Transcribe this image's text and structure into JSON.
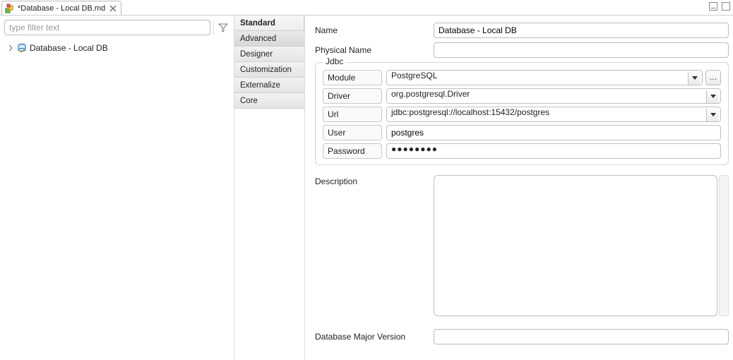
{
  "tab": {
    "title": "*Database - Local DB.md"
  },
  "filter": {
    "placeholder": "type filter text"
  },
  "tree": {
    "root_label": "Database - Local DB"
  },
  "prop_section": {
    "header": "Standard",
    "items": [
      "Advanced",
      "Designer",
      "Customization",
      "Externalize",
      "Core"
    ],
    "selected_index": 0
  },
  "form": {
    "name_label": "Name",
    "name_value": "Database - Local DB",
    "physical_name_label": "Physical Name",
    "physical_name_value": "",
    "description_label": "Description",
    "description_value": "",
    "db_major_label": "Database Major Version",
    "db_major_value": ""
  },
  "jdbc": {
    "group_label": "Jdbc",
    "module_label": "Module",
    "module_value": "PostgreSQL",
    "driver_label": "Driver",
    "driver_value": "org.postgresql.Driver",
    "url_label": "Url",
    "url_value": "jdbc:postgresql://localhost:15432/postgres",
    "user_label": "User",
    "user_value": "postgres",
    "password_label": "Password",
    "password_value": "●●●●●●●●",
    "browse": "…"
  }
}
